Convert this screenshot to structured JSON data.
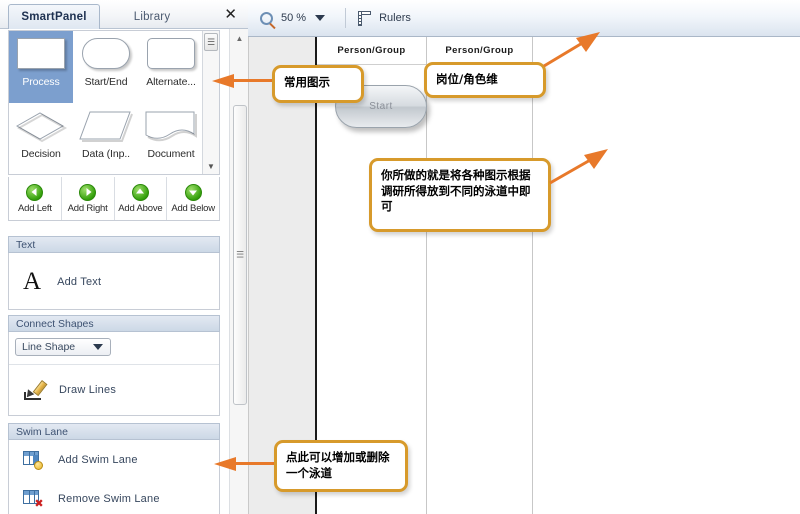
{
  "panel": {
    "tabs": [
      {
        "label": "SmartPanel",
        "active": true
      },
      {
        "label": "Library",
        "active": false
      }
    ],
    "close_label": "✕",
    "gallery": {
      "rows": [
        [
          {
            "caption": "Process",
            "shape": "rect",
            "selected": true
          },
          {
            "caption": "Start/End",
            "shape": "round",
            "selected": false
          },
          {
            "caption": "Alternate...",
            "shape": "rrect",
            "selected": false
          }
        ],
        [
          {
            "caption": "Decision",
            "shape": "diamond",
            "selected": false
          },
          {
            "caption": "Data (Inp..",
            "shape": "para",
            "selected": false
          },
          {
            "caption": "Document",
            "shape": "doc",
            "selected": false
          }
        ]
      ],
      "scroll_up": "▲",
      "scroll_down": "▼",
      "scroll_grip": "☰"
    },
    "add_buttons": [
      {
        "label": "Add Left",
        "dir": "left"
      },
      {
        "label": "Add Right",
        "dir": "right"
      },
      {
        "label": "Add Above",
        "dir": "up"
      },
      {
        "label": "Add Below",
        "dir": "down"
      }
    ],
    "sections": [
      {
        "title": "Text",
        "items": [
          {
            "label": "Add Text",
            "icon": "letter-a-icon"
          }
        ]
      },
      {
        "title": "Connect Shapes",
        "dropdown": {
          "value": "Line Shape"
        },
        "items": [
          {
            "label": "Draw Lines",
            "icon": "pencil-icon"
          }
        ]
      },
      {
        "title": "Swim Lane",
        "items": [
          {
            "label": "Add Swim Lane",
            "icon": "add-swimlane-icon"
          },
          {
            "label": "Remove Swim Lane",
            "icon": "remove-swimlane-icon"
          }
        ]
      }
    ],
    "scrollbar": {
      "up": "▲",
      "down": "▼",
      "grip": "☰"
    }
  },
  "toolbar": {
    "zoom_icon": "magnifier-icon",
    "zoom_value": "50 %",
    "rulers_icon": "ruler-icon",
    "rulers_label": "Rulers"
  },
  "diagram": {
    "lanes": [
      {
        "header": "Person/Group"
      },
      {
        "header": "Person/Group"
      },
      {
        "header": ""
      }
    ],
    "shapes": [
      {
        "type": "start-end",
        "label": "Start",
        "lane": 0
      }
    ]
  },
  "annotations": [
    {
      "id": "callout-common-shapes",
      "text": "常用图示"
    },
    {
      "id": "callout-role-dimension",
      "text": "岗位/角色维"
    },
    {
      "id": "callout-instruction",
      "text": "你所做的就是将各种图示根据调研所得放到不同的泳道中即可"
    },
    {
      "id": "callout-swimlane-hint",
      "text": "点此可以增加或删除一个泳道"
    }
  ],
  "colors": {
    "callout_border": "#d79a2b",
    "arrow": "#e8792a",
    "selected_shape": "#7c9fce",
    "canvas_bg": "#ececec"
  }
}
